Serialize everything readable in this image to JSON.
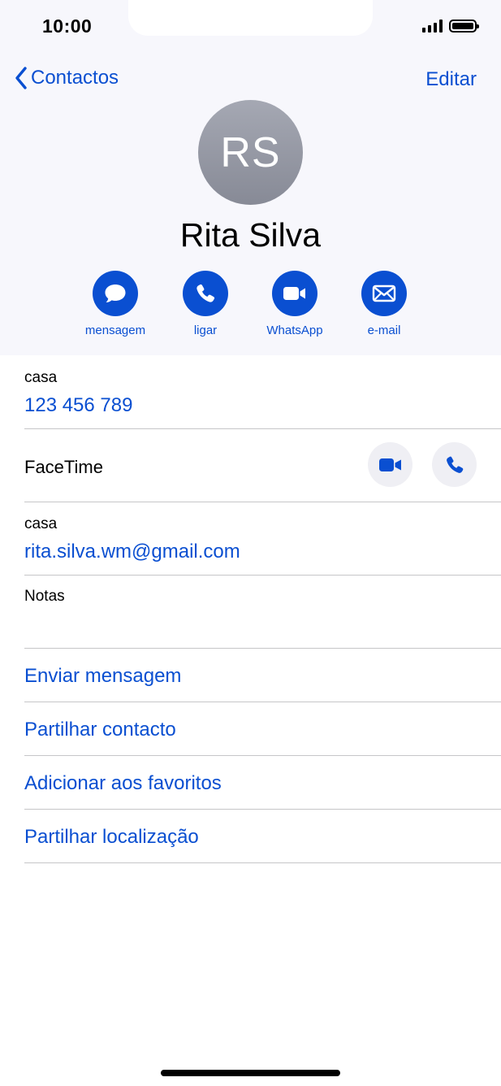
{
  "status_bar": {
    "time": "10:00"
  },
  "nav": {
    "back_label": "Contactos",
    "edit_label": "Editar"
  },
  "contact": {
    "initials": "RS",
    "name": "Rita Silva"
  },
  "actions": [
    {
      "label": "mensagem",
      "icon": "message-bubble-icon"
    },
    {
      "label": "ligar",
      "icon": "phone-icon"
    },
    {
      "label": "WhatsApp",
      "icon": "video-camera-icon"
    },
    {
      "label": "e-mail",
      "icon": "envelope-icon"
    }
  ],
  "details": {
    "phone": {
      "label": "casa",
      "value": "123 456 789"
    },
    "facetime": {
      "label": "FaceTime"
    },
    "email": {
      "label": "casa",
      "value": "rita.silva.wm@gmail.com"
    },
    "notes": {
      "label": "Notas"
    }
  },
  "links": [
    "Enviar mensagem",
    "Partilhar contacto",
    "Adicionar aos favoritos",
    "Partilhar localização"
  ],
  "colors": {
    "accent": "#0a4fd1",
    "header_bg": "#f7f7fc",
    "avatar_gradient_top": "#a5a8b3",
    "avatar_gradient_bottom": "#878a96",
    "divider": "#c6c6c8"
  }
}
